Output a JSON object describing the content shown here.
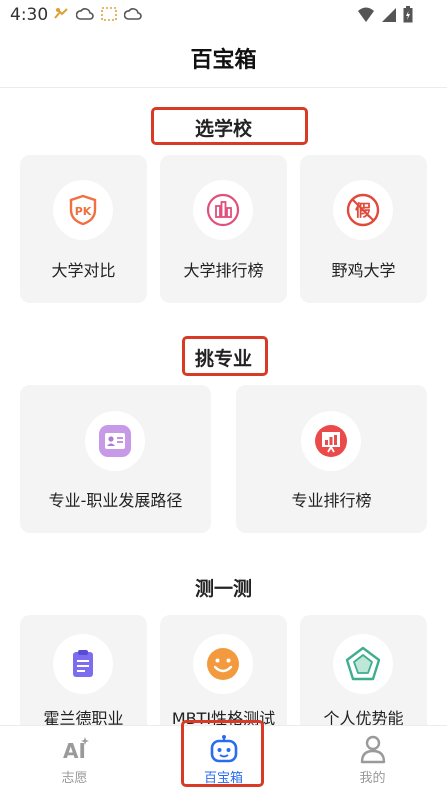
{
  "status": {
    "time": "4:30"
  },
  "page": {
    "title": "百宝箱"
  },
  "sections": {
    "school": {
      "title": "选学校",
      "cards": [
        {
          "label": "大学对比",
          "icon": "pk-shield-icon"
        },
        {
          "label": "大学排行榜",
          "icon": "bar-chart-icon"
        },
        {
          "label": "野鸡大学",
          "icon": "fake-stamp-icon"
        }
      ]
    },
    "major": {
      "title": "挑专业",
      "cards": [
        {
          "label": "专业-职业发展路径",
          "icon": "id-card-icon"
        },
        {
          "label": "专业排行榜",
          "icon": "ranking-board-icon"
        }
      ]
    },
    "test": {
      "title": "测一测",
      "cards": [
        {
          "label": "霍兰德职业",
          "icon": "clipboard-icon"
        },
        {
          "label": "MBTI性格测试",
          "icon": "smiley-icon"
        },
        {
          "label": "个人优势能",
          "icon": "pentagon-radar-icon"
        }
      ]
    }
  },
  "tabs": [
    {
      "label": "志愿",
      "icon": "ai-star-icon"
    },
    {
      "label": "百宝箱",
      "icon": "robot-icon",
      "active": true
    },
    {
      "label": "我的",
      "icon": "person-icon"
    }
  ],
  "colors": {
    "accent": "#2a6cf0",
    "highlight": "#d83a25",
    "card_bg": "#f4f4f4"
  }
}
